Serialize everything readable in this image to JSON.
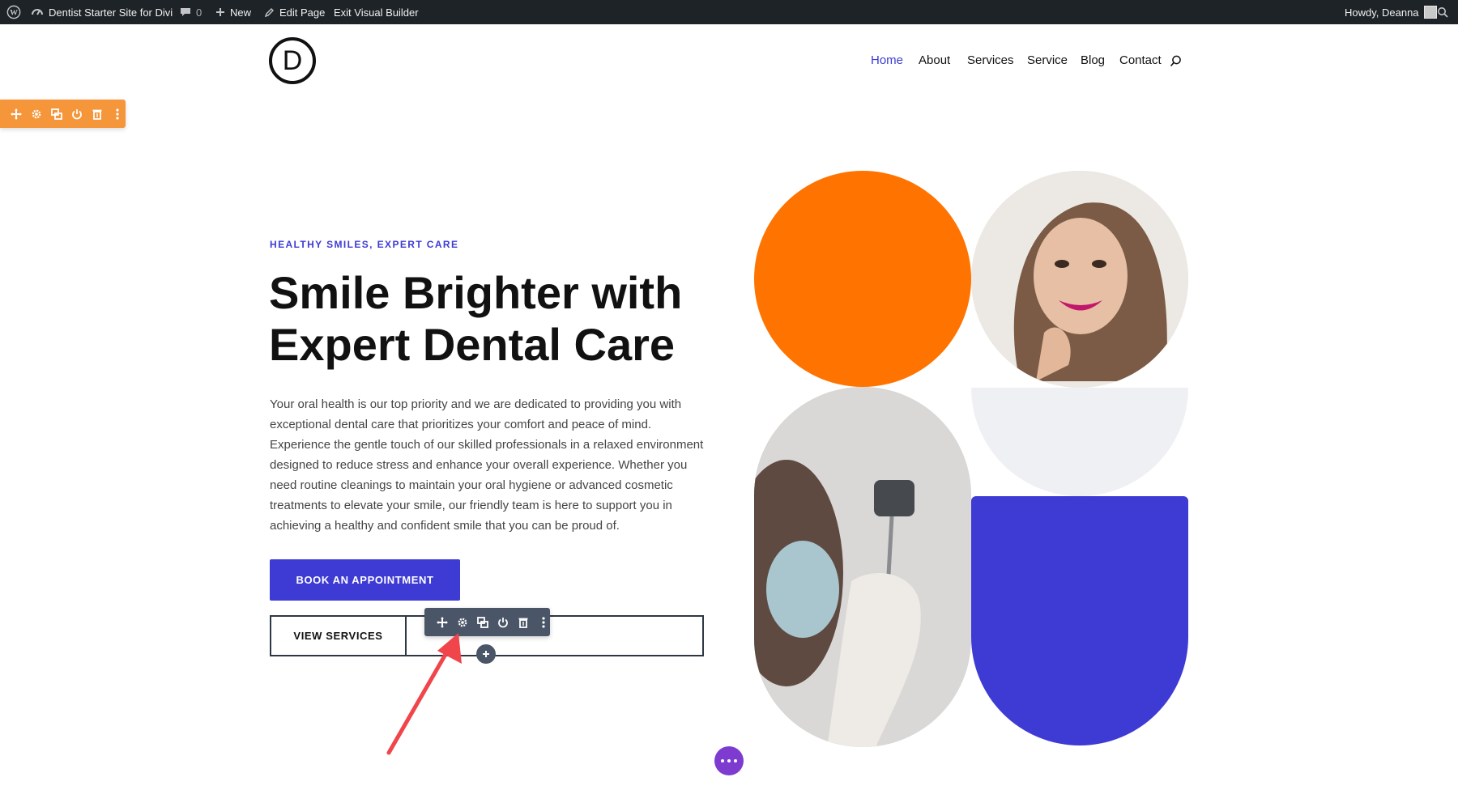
{
  "admin_bar": {
    "site_name": "Dentist Starter Site for Divi",
    "comments_count": "0",
    "new_label": "New",
    "edit_label": "Edit Page",
    "exit_label": "Exit Visual Builder",
    "greeting": "Howdy, Deanna"
  },
  "header": {
    "logo_letter": "D",
    "nav": [
      "Home",
      "About",
      "Services",
      "Service",
      "Blog",
      "Contact"
    ],
    "active_nav": "Home"
  },
  "hero": {
    "eyebrow": "HEALTHY SMILES, EXPERT CARE",
    "title_lines": [
      "Smile Brighter with",
      "Expert Dental Care"
    ],
    "body_lines": [
      "Your oral health is our top priority and we are dedicated to providing you with",
      "exceptional dental care that prioritizes your comfort and peace of mind.",
      "Experience the gentle touch of our skilled professionals in a relaxed environment",
      "designed to reduce stress and enhance your overall experience. Whether you",
      "need routine cleanings to maintain your oral hygiene or advanced cosmetic",
      "treatments to elevate your smile, our friendly team is here to support you in",
      "achieving a healthy and confident smile that you can be proud of."
    ],
    "primary_button": "BOOK AN APPOINTMENT",
    "secondary_button": "VIEW SERVICES"
  },
  "builder": {
    "toolbar_icons": [
      "move-icon",
      "settings-icon",
      "duplicate-icon",
      "toggle-icon",
      "trash-icon",
      "more-icon"
    ]
  },
  "colors": {
    "admin_bar_bg": "#1d2327",
    "accent_blue": "#3d3bd3",
    "accent_orange": "#ff7300",
    "row_toolbar": "#f5963a",
    "module_toolbar": "#4a5567",
    "page_settings": "#7e3bd0",
    "annotation_arrow": "#f0454a"
  }
}
